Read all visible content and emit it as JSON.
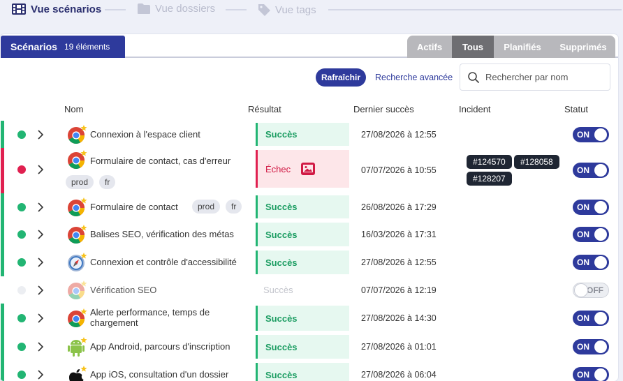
{
  "nav": {
    "scenarios": "Vue scénarios",
    "folders": "Vue dossiers",
    "tags": "Vue tags"
  },
  "panel": {
    "tab_title": "Scénarios",
    "tab_count": "19 éléments",
    "filters": [
      "Actifs",
      "Tous",
      "Planifiés",
      "Supprimés"
    ],
    "active_filter": "Tous"
  },
  "toolbar": {
    "refresh": "Rafraîchir",
    "advanced_search": "Recherche avancée",
    "search_placeholder": "Rechercher par nom"
  },
  "columns": {
    "name": "Nom",
    "result": "Résultat",
    "last_success": "Dernier succès",
    "incident": "Incident",
    "status": "Statut"
  },
  "toggle_labels": {
    "on": "ON",
    "off": "OFF"
  },
  "colors": {
    "brand": "#2e3a9c",
    "success": "#22b573",
    "failure": "#e02050"
  },
  "rows": [
    {
      "name": "Connexion à l'espace client",
      "app": "chrome",
      "result": "Succès",
      "state": "ok",
      "date": "27/08/2026 à 12:55",
      "tags": [],
      "incidents": [],
      "enabled": true
    },
    {
      "name": "Formulaire de contact, cas d'erreur",
      "app": "chrome",
      "result": "Échec",
      "state": "ko",
      "date": "07/07/2026 à 10:55",
      "tags": [
        "prod",
        "fr"
      ],
      "incidents": [
        "#124570",
        "#128058",
        "#128207"
      ],
      "enabled": true
    },
    {
      "name": "Formulaire de contact",
      "app": "chrome",
      "result": "Succès",
      "state": "ok",
      "date": "26/08/2026 à 17:29",
      "tags": [
        "prod",
        "fr"
      ],
      "incidents": [],
      "enabled": true
    },
    {
      "name": "Balises SEO, vérification des métas",
      "app": "chrome",
      "result": "Succès",
      "state": "ok",
      "date": "16/03/2026 à 17:31",
      "tags": [],
      "incidents": [],
      "enabled": true
    },
    {
      "name": "Connexion et contrôle d'accessibilité",
      "app": "safari",
      "result": "Succès",
      "state": "ok",
      "date": "27/08/2026 à 12:55",
      "tags": [],
      "incidents": [],
      "enabled": true
    },
    {
      "name": "Vérification SEO",
      "app": "chrome",
      "result": "Succès",
      "state": "off",
      "date": "07/07/2026 à 12:19",
      "tags": [],
      "incidents": [],
      "enabled": false
    },
    {
      "name": "Alerte performance, temps de chargement",
      "app": "chrome",
      "result": "Succès",
      "state": "ok",
      "date": "27/08/2026 à 14:30",
      "tags": [],
      "incidents": [],
      "enabled": true
    },
    {
      "name": "App Android, parcours d'inscription",
      "app": "android",
      "result": "Succès",
      "state": "ok",
      "date": "27/08/2026 à 01:01",
      "tags": [],
      "incidents": [],
      "enabled": true
    },
    {
      "name": "App iOS, consultation d'un dossier",
      "app": "apple",
      "result": "Succès",
      "state": "ok",
      "date": "27/08/2026 à 06:04",
      "tags": [],
      "incidents": [],
      "enabled": true
    }
  ]
}
